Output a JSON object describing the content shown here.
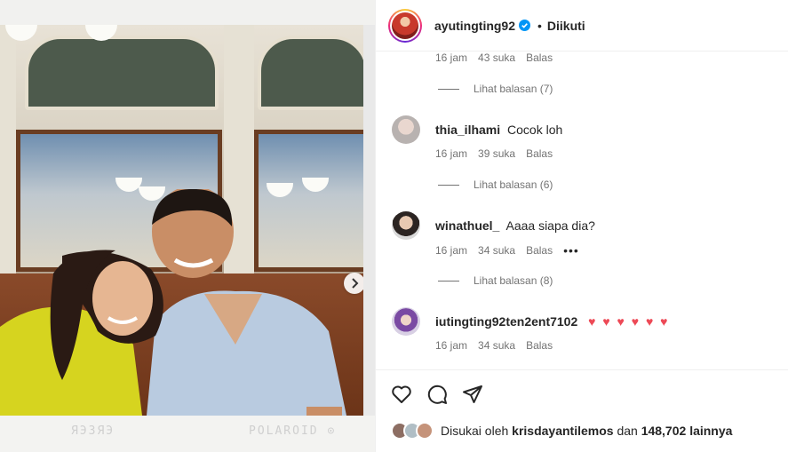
{
  "post": {
    "username": "ayutingting92",
    "follow_status": "Diikuti",
    "dot": "•"
  },
  "comments": [
    {
      "meta": {
        "time": "16 jam",
        "likes": "43 suka",
        "reply": "Balas"
      },
      "view_replies": "Lihat balasan (7)"
    },
    {
      "username": "thia_ilhami",
      "text": "Cocok loh",
      "meta": {
        "time": "16 jam",
        "likes": "39 suka",
        "reply": "Balas"
      },
      "view_replies": "Lihat balasan (6)"
    },
    {
      "username": "winathuel_",
      "text": "Aaaa siapa dia?",
      "meta": {
        "time": "16 jam",
        "likes": "34 suka",
        "reply": "Balas"
      },
      "more": "•••",
      "view_replies": "Lihat balasan (8)"
    },
    {
      "username": "iutingting92ten2ent7102",
      "text": "♥ ♥ ♥ ♥ ♥ ♥",
      "meta": {
        "time": "16 jam",
        "likes": "34 suka",
        "reply": "Balas"
      }
    }
  ],
  "likes": {
    "prefix": "Disukai oleh",
    "user": "krisdayantilemos",
    "connector": "dan",
    "count": "148,702",
    "suffix": "lainnya"
  },
  "photo_text": {
    "scribble_left": "ЯЭЗЯЭ",
    "scribble_right": "POLAROID ⊙"
  },
  "icons": {
    "verified": "verified-badge-icon",
    "like": "heart-icon",
    "comment": "comment-icon",
    "share": "share-icon",
    "next": "chevron-right-icon"
  },
  "colors": {
    "accent_blue": "#0095f6",
    "heart_red": "#ed4956",
    "muted": "#737373"
  }
}
